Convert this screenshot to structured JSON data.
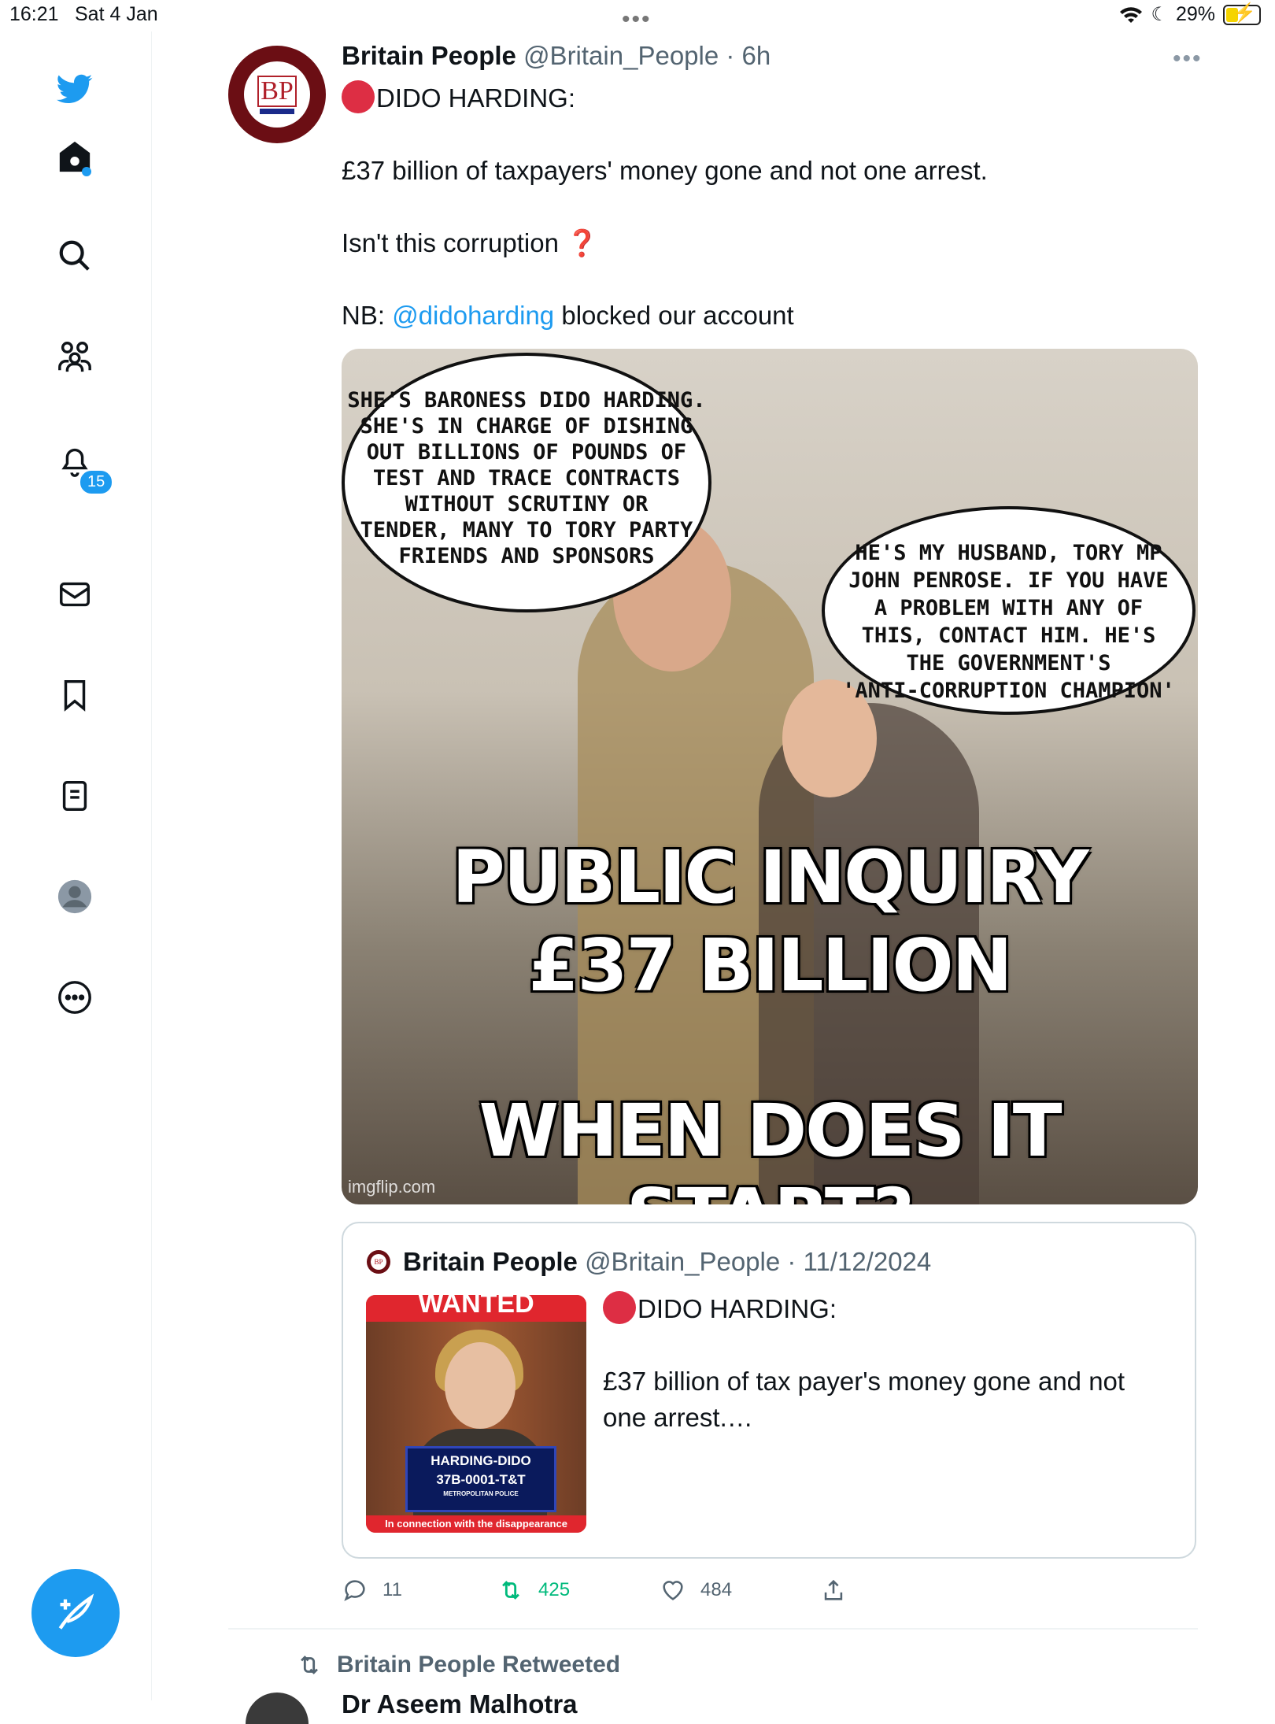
{
  "status_bar": {
    "time": "16:21",
    "date": "Sat 4 Jan",
    "battery": "29%",
    "battery_level": 0.29
  },
  "sidebar": {
    "items": [
      {
        "icon": "twitter-bird-icon"
      },
      {
        "icon": "home-icon"
      },
      {
        "icon": "search-icon"
      },
      {
        "icon": "communities-icon"
      },
      {
        "icon": "notifications-icon",
        "badge": "15"
      },
      {
        "icon": "messages-icon"
      },
      {
        "icon": "bookmarks-icon"
      },
      {
        "icon": "lists-icon"
      },
      {
        "icon": "profile-icon"
      },
      {
        "icon": "more-icon"
      }
    ],
    "compose_icon": "compose-icon"
  },
  "tweet": {
    "name": "Britain People",
    "handle": "@Britain_People",
    "time": "· 6h",
    "avatar_text": "BP",
    "line1": "DIDO HARDING:",
    "line2": "£37 billion of taxpayers' money gone and not one arrest.",
    "line3": "Isn't this corruption",
    "line3_mark": "❓",
    "line4_prefix": "NB: ",
    "line4_mention": "@didoharding",
    "line4_suffix": " blocked our account",
    "image": {
      "bubble_left": [
        "SHE'S BARONESS DIDO HARDING.",
        "SHE'S IN CHARGE OF DISHING",
        "OUT BILLIONS OF POUNDS OF",
        "TEST AND TRACE CONTRACTS",
        "WITHOUT SCRUTINY OR",
        "TENDER, MANY TO TORY PARTY",
        "FRIENDS  AND SPONSORS"
      ],
      "bubble_right": [
        "HE'S MY HUSBAND, TORY MP",
        "JOHN PENROSE. IF YOU HAVE",
        "A PROBLEM WITH ANY OF",
        "THIS, CONTACT HIM. HE'S",
        "THE GOVERNMENT'S",
        "'ANTI-CORRUPTION CHAMPION'"
      ],
      "headline1": "PUBLIC INQUIRY",
      "headline2": "£37 BILLION",
      "headline3": "WHEN DOES IT START?",
      "watermark": "imgflip.com"
    },
    "quote": {
      "avatar_text": "BP",
      "name": "Britain People",
      "handle": "@Britain_People",
      "date": "· 11/12/2024",
      "line1": "DIDO HARDING:",
      "line2": "£37 billion of tax payer's money gone and not",
      "line3": "one arrest.…",
      "thumb": {
        "banner": "WANTED",
        "plate1": "HARDING-DIDO",
        "plate2": "37B-0001-T&T",
        "plate3": "METROPOLITAN POLICE",
        "caption": "In connection with the disappearance"
      }
    },
    "actions": {
      "reply_count": "11",
      "retweet_count": "425",
      "like_count": "484",
      "share_icon": "share-icon"
    }
  },
  "next_item": {
    "retweeted_label": "Britain People Retweeted",
    "name_peek": "Dr Aseem Malhotra"
  },
  "colors": {
    "accent": "#1d9bf0",
    "retweet_green": "#00ba7c",
    "text_secondary": "#536471"
  }
}
